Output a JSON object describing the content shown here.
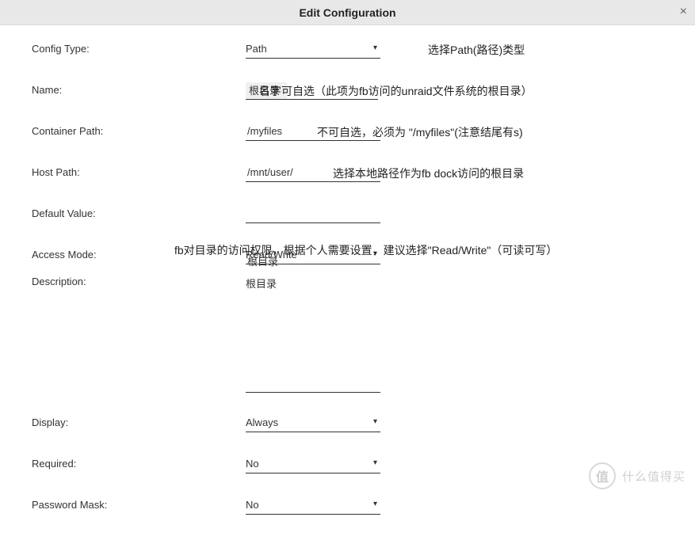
{
  "title": "Edit Configuration",
  "close_label": "×",
  "fields": {
    "config_type": {
      "label": "Config Type:",
      "value": "Path",
      "annotation": "选择Path(路径)类型"
    },
    "name": {
      "label": "Name:",
      "value": "根目录",
      "annotation": "名字可自选（此项为fb访问的unraid文件系统的根目录）"
    },
    "container_path": {
      "label": "Container Path:",
      "value": "/myfiles",
      "annotation": "不可自选，必须为 \"/myfiles\"(注意结尾有s)"
    },
    "host_path": {
      "label": "Host Path:",
      "value": "/mnt/user/",
      "annotation": "选择本地路径作为fb dock访问的根目录"
    },
    "default_value": {
      "label": "Default Value:",
      "value": ""
    },
    "access_mode": {
      "label": "Access Mode:",
      "value": "Read/Write",
      "annotation": "fb对目录的访问权限，根据个人需要设置，建议选择\"Read/Write\"（可读可写）"
    },
    "description": {
      "label": "Description:",
      "value": "根目录"
    },
    "display": {
      "label": "Display:",
      "value": "Always"
    },
    "required": {
      "label": "Required:",
      "value": "No"
    },
    "password_mask": {
      "label": "Password Mask:",
      "value": "No"
    }
  },
  "watermark": {
    "icon": "值",
    "text": "什么值得买"
  }
}
